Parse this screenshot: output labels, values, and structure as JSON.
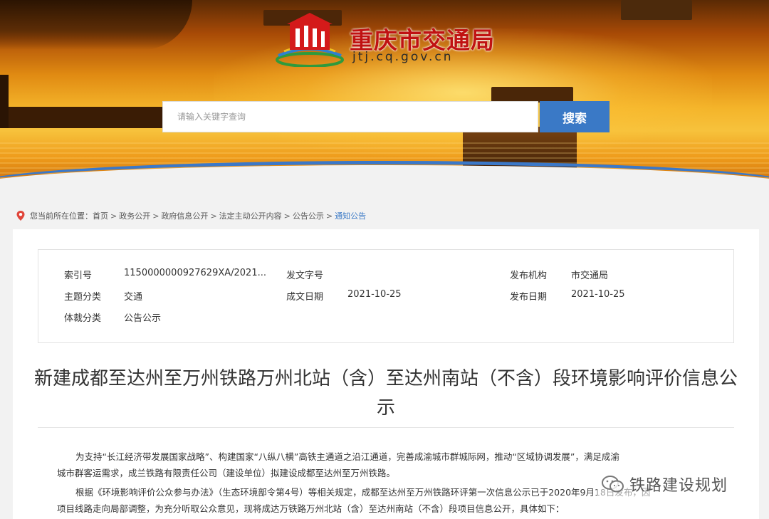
{
  "header": {
    "site_title": "重庆市交通局",
    "site_url": "jtj.cq.gov.cn"
  },
  "search": {
    "placeholder": "请输入关键字查询",
    "button_label": "搜索"
  },
  "breadcrumb": {
    "prefix": "您当前所在位置：",
    "items": [
      "首页",
      "政务公开",
      "政府信息公开",
      "法定主动公开内容",
      "公告公示",
      "通知公告"
    ],
    "separator": ">"
  },
  "meta": {
    "index_label": "索引号",
    "index_value": "1150000000927629XA/2021...",
    "doc_no_label": "发文字号",
    "doc_no_value": "",
    "issuer_label": "发布机构",
    "issuer_value": "市交通局",
    "topic_label": "主题分类",
    "topic_value": "交通",
    "written_date_label": "成文日期",
    "written_date_value": "2021-10-25",
    "publish_date_label": "发布日期",
    "publish_date_value": "2021-10-25",
    "genre_label": "体裁分类",
    "genre_value": "公告公示"
  },
  "article": {
    "title_line1": "新建成都至达州至万州铁路万州北站（含）至达州南站（不含）段环境影响评价信息公",
    "title_line2": "示",
    "para1_line1": "为支持“长江经济带发展国家战略”、构建国家“八纵八横”高铁主通道之沿江通道，完善成渝城市群城际网，推动“区域协调发展”，满足成渝",
    "para1_line2": "城市群客运需求，成兰铁路有限责任公司（建设单位）拟建设成都至达州至万州铁路。",
    "para2_line1": "根据《环境影响评价公众参与办法》（生态环境部令第4号）等相关规定，成都至达州至万州铁路环评第一次信息公示已于2020年9月18日发布，因",
    "para2_line2": "项目线路走向局部调整，为充分听取公众意见，现将成达万铁路万州北站（含）至达州南站（不含）段项目信息公开，具体如下："
  },
  "watermark": {
    "text": "铁路建设规划"
  },
  "colors": {
    "accent_blue": "#3a79c6",
    "title_red": "#c01212"
  }
}
